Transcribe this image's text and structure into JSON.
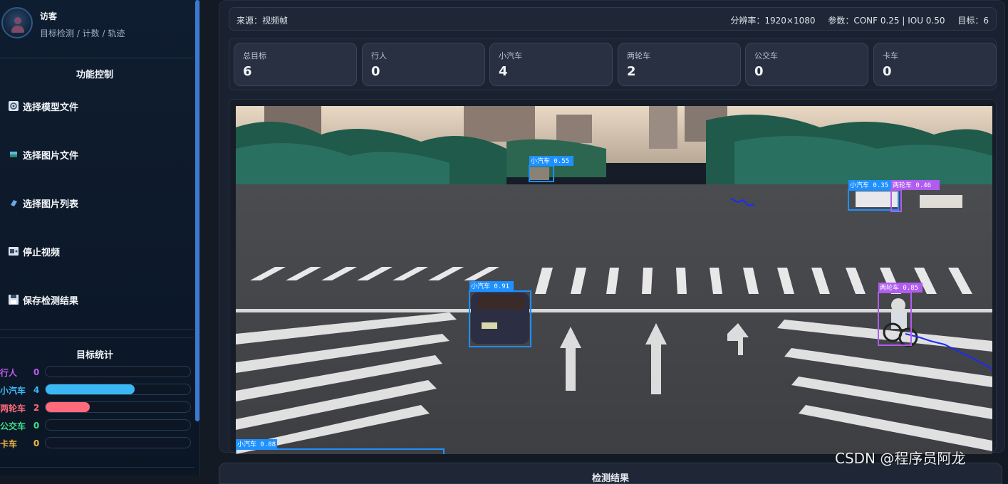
{
  "user": {
    "name": "访客",
    "subtitle": "目标检测 / 计数 / 轨迹"
  },
  "controls": {
    "title": "功能控制",
    "items": [
      {
        "label": "选择模型文件",
        "icon": "model-icon"
      },
      {
        "label": "选择图片文件",
        "icon": "image-icon"
      },
      {
        "label": "选择图片列表",
        "icon": "list-icon"
      },
      {
        "label": "停止视频",
        "icon": "video-icon"
      },
      {
        "label": "保存检测结果",
        "icon": "save-icon"
      }
    ]
  },
  "stats": {
    "title": "目标统计",
    "max": 6.5,
    "items": [
      {
        "label": "行人",
        "value": 0,
        "color": "#c05cf0",
        "fill": "#c05cf0"
      },
      {
        "label": "小汽车",
        "value": 4,
        "color": "#3ab8f5",
        "fill": "#3ab8f5"
      },
      {
        "label": "两轮车",
        "value": 2,
        "color": "#ff6b7a",
        "fill": "#ff6b7a"
      },
      {
        "label": "公交车",
        "value": 0,
        "color": "#3fe08a",
        "fill": "#3fe08a"
      },
      {
        "label": "卡车",
        "value": 0,
        "color": "#f5b942",
        "fill": "#f5b942"
      }
    ]
  },
  "info": {
    "source": "来源：视频帧",
    "resolution": "分辨率：1920×1080",
    "params": "参数：CONF 0.25 | IOU 0.50",
    "targets": "目标：6"
  },
  "cards": [
    {
      "label": "总目标",
      "value": "6"
    },
    {
      "label": "行人",
      "value": "0"
    },
    {
      "label": "小汽车",
      "value": "4"
    },
    {
      "label": "两轮车",
      "value": "2"
    },
    {
      "label": "公交车",
      "value": "0"
    },
    {
      "label": "卡车",
      "value": "0"
    }
  ],
  "detections": [
    {
      "label": "小汽车 0.55",
      "color": "#1e90ff"
    },
    {
      "label": "小汽车 0.35",
      "color": "#1e90ff"
    },
    {
      "label": "两轮车 0.46",
      "color": "#b05cf0"
    },
    {
      "label": "小汽车 0.91",
      "color": "#1e90ff"
    },
    {
      "label": "两轮车 0.85",
      "color": "#b05cf0"
    },
    {
      "label": "小汽车 0.88",
      "color": "#1e90ff"
    }
  ],
  "result_title": "检测结果",
  "watermark": "CSDN @程序员阿龙"
}
